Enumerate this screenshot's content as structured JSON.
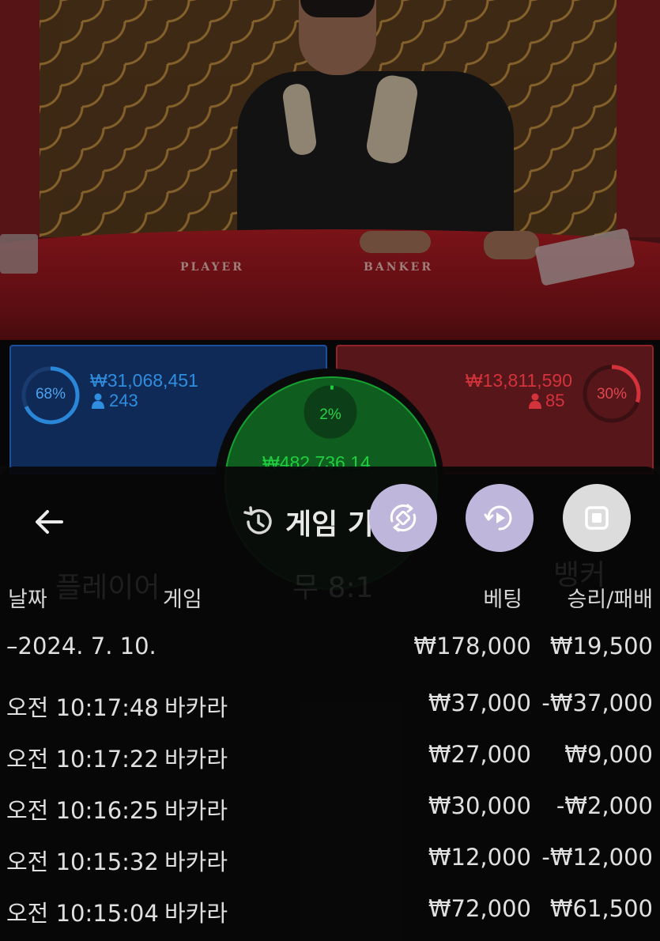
{
  "video": {
    "table_labels": {
      "player": "PLAYER",
      "banker": "BANKER"
    }
  },
  "stats": {
    "player": {
      "percent": "68%",
      "percent_value": 68,
      "amount": "₩31,068,451",
      "count": "243"
    },
    "tie": {
      "percent": "2%",
      "percent_value": 2,
      "amount": "₩482,736.14"
    },
    "banker": {
      "percent": "30%",
      "percent_value": 30,
      "amount": "₩13,811,590",
      "count": "85"
    },
    "colors": {
      "player": "#2a86d6",
      "banker": "#d4333b",
      "tie": "#1fcf3f"
    }
  },
  "sheet": {
    "title": "게임 기",
    "background_labels": {
      "player": "플레이어",
      "tie": "무 8:1",
      "banker": "뱅커"
    },
    "columns": {
      "date": "날짜",
      "game": "게임",
      "bet": "베팅",
      "result": "승리/패배"
    },
    "summary": {
      "date": "–2024. 7. 10.",
      "bet": "₩178,000",
      "result": "₩19,500"
    },
    "rows": [
      {
        "time": "오전 10:17:48",
        "game": "바카라",
        "bet": "₩37,000",
        "result": "-₩37,000"
      },
      {
        "time": "오전 10:17:22",
        "game": "바카라",
        "bet": "₩27,000",
        "result": "₩9,000"
      },
      {
        "time": "오전 10:16:25",
        "game": "바카라",
        "bet": "₩30,000",
        "result": "-₩2,000"
      },
      {
        "time": "오전 10:15:32",
        "game": "바카라",
        "bet": "₩12,000",
        "result": "-₩12,000"
      },
      {
        "time": "오전 10:15:04",
        "game": "바카라",
        "bet": "₩72,000",
        "result": "₩61,500"
      }
    ]
  }
}
